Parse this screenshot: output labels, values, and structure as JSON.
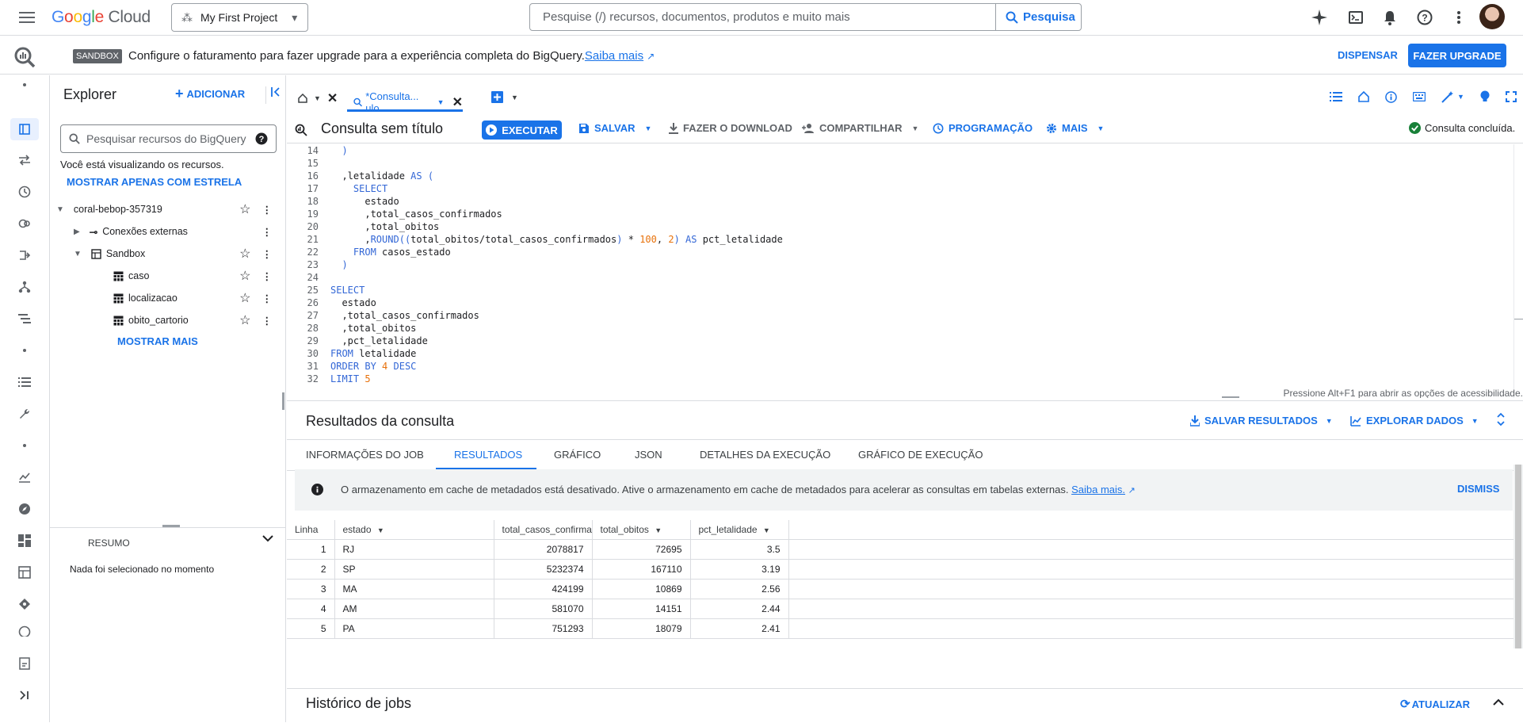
{
  "topbar": {
    "logo_google": "Google",
    "logo_cloud": "Cloud",
    "project": "My First Project",
    "search_placeholder": "Pesquise (/) recursos, documentos, produtos e muito mais",
    "search_button": "Pesquisa"
  },
  "banner": {
    "badge": "SANDBOX",
    "text": "Configure o faturamento para fazer upgrade para a experiência completa do BigQuery.",
    "link": "Saiba mais",
    "dismiss": "DISPENSAR",
    "upgrade": "FAZER UPGRADE"
  },
  "explorer": {
    "title": "Explorer",
    "add": "ADICIONAR",
    "search_placeholder": "Pesquisar recursos do BigQuery",
    "viewing": "Você está visualizando os recursos.",
    "show_starred": "MOSTRAR APENAS COM ESTRELA",
    "project": "coral-bebop-357319",
    "external": "Conexões externas",
    "dataset": "Sandbox",
    "tables": [
      "caso",
      "localizacao",
      "obito_cartorio"
    ],
    "show_more": "MOSTRAR MAIS",
    "summary": "RESUMO",
    "nothing_selected": "Nada foi selecionado no momento"
  },
  "tabs": {
    "query_tab": "*Consulta... ulo"
  },
  "query": {
    "title": "Consulta sem título",
    "execute": "EXECUTAR",
    "save": "SALVAR",
    "download": "FAZER O DOWNLOAD",
    "share": "COMPARTILHAR",
    "schedule": "PROGRAMAÇÃO",
    "more": "MAIS",
    "status": "Consulta concluída.",
    "accessibility": "Pressione Alt+F1 para abrir as opções de acessibilidade."
  },
  "code": [
    {
      "n": "14",
      "t": "  )"
    },
    {
      "n": "15",
      "t": ""
    },
    {
      "n": "16",
      "t": "  ,letalidade AS ("
    },
    {
      "n": "17",
      "t": "    SELECT"
    },
    {
      "n": "18",
      "t": "      estado"
    },
    {
      "n": "19",
      "t": "      ,total_casos_confirmados"
    },
    {
      "n": "20",
      "t": "      ,total_obitos"
    },
    {
      "n": "21",
      "t": "      ,ROUND((total_obitos/total_casos_confirmados) * 100, 2) AS pct_letalidade"
    },
    {
      "n": "22",
      "t": "    FROM casos_estado"
    },
    {
      "n": "23",
      "t": "  )"
    },
    {
      "n": "24",
      "t": ""
    },
    {
      "n": "25",
      "t": "SELECT"
    },
    {
      "n": "26",
      "t": "  estado"
    },
    {
      "n": "27",
      "t": "  ,total_casos_confirmados"
    },
    {
      "n": "28",
      "t": "  ,total_obitos"
    },
    {
      "n": "29",
      "t": "  ,pct_letalidade"
    },
    {
      "n": "30",
      "t": "FROM letalidade"
    },
    {
      "n": "31",
      "t": "ORDER BY 4 DESC"
    },
    {
      "n": "32",
      "t": "LIMIT 5"
    }
  ],
  "results": {
    "title": "Resultados da consulta",
    "save_results": "SALVAR RESULTADOS",
    "explore": "EXPLORAR DADOS",
    "tabs": [
      "INFORMAÇÕES DO JOB",
      "RESULTADOS",
      "GRÁFICO",
      "JSON",
      "DETALHES DA EXECUÇÃO",
      "GRÁFICO DE EXECUÇÃO"
    ],
    "cache_note": "O armazenamento em cache de metadados está desativado. Ative o armazenamento em cache de metadados para acelerar as consultas em tabelas externas.",
    "cache_link": "Saiba mais.",
    "dismiss": "DISMISS",
    "columns": [
      "Linha",
      "estado",
      "total_casos_confirma",
      "total_obitos",
      "pct_letalidade"
    ],
    "rows": [
      [
        "1",
        "RJ",
        "2078817",
        "72695",
        "3.5"
      ],
      [
        "2",
        "SP",
        "5232374",
        "167110",
        "3.19"
      ],
      [
        "3",
        "MA",
        "424199",
        "10869",
        "2.56"
      ],
      [
        "4",
        "AM",
        "581070",
        "14151",
        "2.44"
      ],
      [
        "5",
        "PA",
        "751293",
        "18079",
        "2.41"
      ]
    ]
  },
  "history": {
    "title": "Histórico de jobs",
    "refresh": "ATUALIZAR"
  }
}
